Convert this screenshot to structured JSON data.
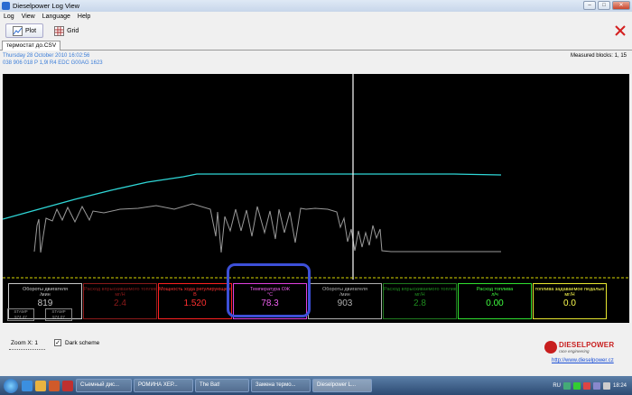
{
  "window": {
    "title": "Dieselpower Log View"
  },
  "menu": [
    "Log",
    "View",
    "Language",
    "Help"
  ],
  "toolbar": {
    "plot": "Plot",
    "grid": "Grid"
  },
  "tab": {
    "file": "термостат до.CSV"
  },
  "info": {
    "date": "Thursday 28 October 2010 16:02:56",
    "ecu": "038 906 018 P  1,9l R4 EDC  G00AG  1623",
    "measured": "Measured blocks: 1, 15"
  },
  "gauges": [
    {
      "name": "Обороты двигателя",
      "unit": "/мин",
      "value": "819",
      "color": "#c8c8c8",
      "value_color": "#c8c8c8"
    },
    {
      "name": "Расход впрыскиваемого топлива",
      "unit": "мг/Н",
      "value": "2.4",
      "color": "#8b1a1a",
      "value_color": "#8b1a1a"
    },
    {
      "name": "Мощность хода регулирующего",
      "unit": "В",
      "value": "1.520",
      "color": "#ff2020",
      "value_color": "#ff3030"
    },
    {
      "name": "Температура ОЖ",
      "unit": "°C",
      "value": "78.3",
      "color": "#e040e0",
      "value_color": "#f060f0"
    },
    {
      "name": "Обороты двигателя",
      "unit": "/мин",
      "value": "903",
      "color": "#b0b0b0",
      "value_color": "#b0b0b0"
    },
    {
      "name": "Расход впрыскиваемого топлива",
      "unit": "мг/Н",
      "value": "2.8",
      "color": "#1f7a1f",
      "value_color": "#1f8a1f"
    },
    {
      "name": "Расход топлива",
      "unit": "л/ч",
      "value": "0.00",
      "color": "#30e030",
      "value_color": "#40ff40"
    },
    {
      "name": "топлива задаваемое педалью",
      "unit": "мг/Н",
      "value": "0.0",
      "color": "#e8e830",
      "value_color": "#ffff50"
    }
  ],
  "stamps": [
    {
      "label": "STAMP",
      "value": "574.47"
    },
    {
      "label": "STAMP",
      "value": "574.07"
    }
  ],
  "bottom": {
    "zoom": "Zoom X: 1",
    "dark_scheme": "Dark scheme",
    "logo_main": "DIESELPOWER",
    "logo_sub": "race engineering",
    "link": "http://www.dieselpower.cz"
  },
  "taskbar": {
    "items": [
      "Съемный дис...",
      "РОМИНА ХЕР...",
      "The Bat!",
      "Замена термо...",
      "Dieselpower L..."
    ],
    "lang": "RU",
    "clock": "18:24"
  },
  "colors": {
    "cyan_trace": "#2fd7d7",
    "gray_trace": "#9a9a9a",
    "cursor": "#ffffff",
    "yellow_trace": "#d8d800",
    "highlight": "#3d50d8"
  }
}
